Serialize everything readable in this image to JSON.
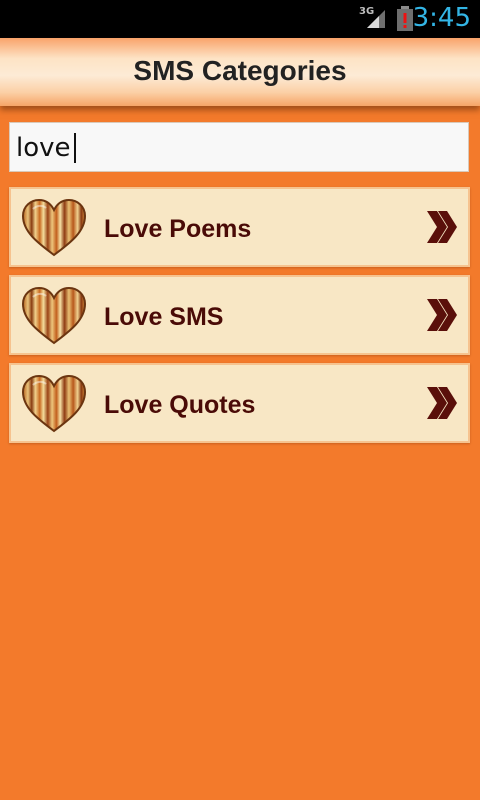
{
  "status_bar": {
    "network_label": "3G",
    "time": "3:45",
    "icons": [
      "signal-icon",
      "battery-alert-icon"
    ],
    "time_color": "#33b5e5"
  },
  "header": {
    "title": "SMS Categories"
  },
  "search": {
    "value": "love",
    "placeholder": ""
  },
  "items": [
    {
      "label": "Love Poems",
      "icon": "heart-icon",
      "arrow": "double-chevron-right-icon"
    },
    {
      "label": "Love SMS",
      "icon": "heart-icon",
      "arrow": "double-chevron-right-icon"
    },
    {
      "label": "Love Quotes",
      "icon": "heart-icon",
      "arrow": "double-chevron-right-icon"
    }
  ],
  "colors": {
    "background": "#f37a2b",
    "item_background": "#f8e7c5",
    "item_text": "#4a0b07",
    "arrow": "#5a0f0a"
  }
}
